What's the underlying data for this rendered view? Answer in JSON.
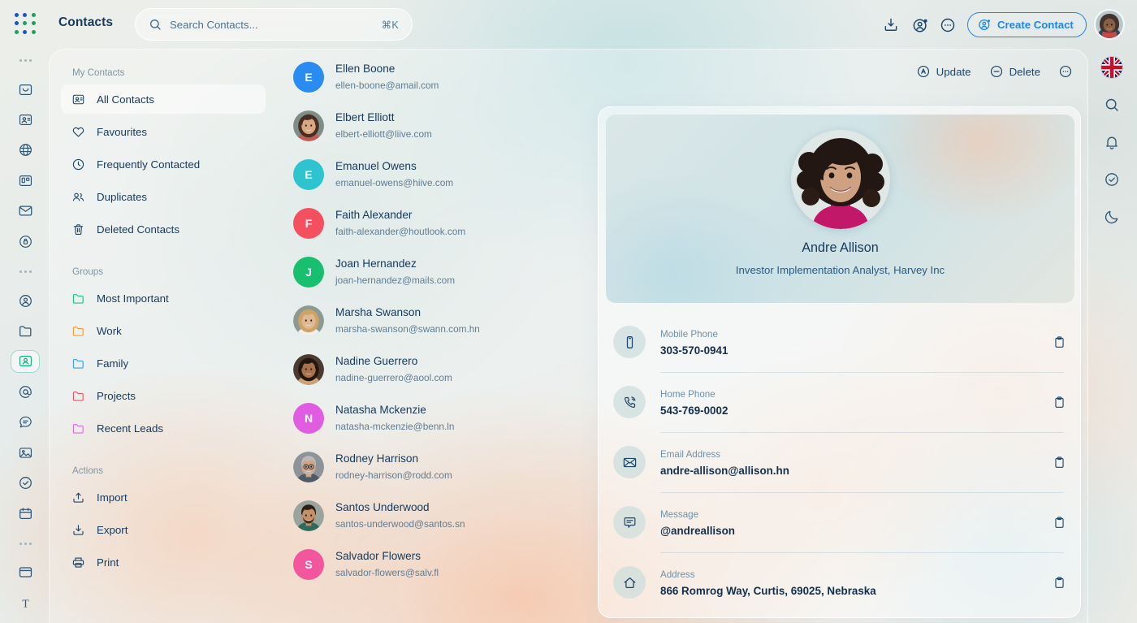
{
  "app": {
    "logo": "grid-dots-logo",
    "logo_colors": [
      "#1955c4",
      "#1955c4",
      "#18a35c",
      "#1955c4",
      "#18a35c",
      "#18a35c",
      "#18a35c",
      "#1955c4",
      "#18a35c"
    ],
    "title": "Contacts",
    "accent": "#1d85f7"
  },
  "search": {
    "placeholder": "Search Contacts...",
    "shortcut": "⌘K",
    "icon": "search-icon"
  },
  "toolbar": {
    "icons": [
      {
        "name": "download-icon"
      },
      {
        "name": "add-user-icon"
      },
      {
        "name": "more-horizontal-icon"
      }
    ],
    "create_contact_label": "Create Contact",
    "create_contact_icon": "user-plus-circle-icon",
    "avatar": "user-avatar"
  },
  "rail_left": {
    "items": [
      {
        "name": "more-dots-icon",
        "type": "dots"
      },
      {
        "name": "inbox-icon",
        "type": "icon"
      },
      {
        "name": "contact-card-icon",
        "type": "icon"
      },
      {
        "name": "globe-icon",
        "type": "icon"
      },
      {
        "name": "kanban-icon",
        "type": "icon"
      },
      {
        "name": "mail-icon",
        "type": "icon"
      },
      {
        "name": "id-badge-icon",
        "type": "icon"
      },
      {
        "name": "more-dots-icon",
        "type": "dots"
      },
      {
        "name": "user-circle-icon",
        "type": "icon"
      },
      {
        "name": "folder-icon",
        "type": "icon"
      },
      {
        "name": "contacts-icon",
        "type": "icon",
        "active": true
      },
      {
        "name": "at-sign-icon",
        "type": "icon"
      },
      {
        "name": "chat-icon",
        "type": "icon"
      },
      {
        "name": "image-icon",
        "type": "icon"
      },
      {
        "name": "check-circle-icon",
        "type": "icon"
      },
      {
        "name": "calendar-icon",
        "type": "icon"
      },
      {
        "name": "more-dots-icon",
        "type": "dots"
      },
      {
        "name": "window-icon",
        "type": "icon"
      },
      {
        "name": "text-icon",
        "type": "icon"
      }
    ]
  },
  "rail_right": {
    "items": [
      {
        "name": "language-flag-uk-icon",
        "type": "flag"
      },
      {
        "name": "search-icon",
        "type": "icon"
      },
      {
        "name": "bell-icon",
        "type": "icon"
      },
      {
        "name": "check-circle-icon",
        "type": "icon"
      },
      {
        "name": "moon-icon",
        "type": "icon"
      }
    ]
  },
  "sidebar": {
    "sections": [
      {
        "title": "My Contacts",
        "items": [
          {
            "label": "All Contacts",
            "icon": "contact-card-icon",
            "selected": true
          },
          {
            "label": "Favourites",
            "icon": "heart-icon",
            "selected": false
          },
          {
            "label": "Frequently Contacted",
            "icon": "clock-icon",
            "selected": false
          },
          {
            "label": "Duplicates",
            "icon": "users-icon",
            "selected": false
          },
          {
            "label": "Deleted Contacts",
            "icon": "trash-icon",
            "selected": false
          }
        ]
      },
      {
        "title": "Groups",
        "items": [
          {
            "label": "Most Important",
            "icon": "folder-icon",
            "color": "#21c08a",
            "selected": false
          },
          {
            "label": "Work",
            "icon": "folder-icon",
            "color": "#f59c3c",
            "selected": false
          },
          {
            "label": "Family",
            "icon": "folder-icon",
            "color": "#3b9cf5",
            "selected": false
          },
          {
            "label": "Projects",
            "icon": "folder-icon",
            "color": "#f2555a",
            "selected": false
          },
          {
            "label": "Recent Leads",
            "icon": "folder-icon",
            "color": "#e06ae0",
            "selected": false
          }
        ]
      },
      {
        "title": "Actions",
        "items": [
          {
            "label": "Import",
            "icon": "upload-icon",
            "selected": false
          },
          {
            "label": "Export",
            "icon": "download-icon",
            "selected": false
          },
          {
            "label": "Print",
            "icon": "printer-icon",
            "selected": false
          }
        ]
      }
    ]
  },
  "contact_list": [
    {
      "name": "Ellen Boone",
      "email": "ellen-boone@amail.com",
      "avatar_type": "initial",
      "initial": "E",
      "color": "#2a8cf0"
    },
    {
      "name": "Elbert Elliott",
      "email": "elbert-elliott@liive.com",
      "avatar_type": "photo",
      "photo": "woman-brown-hair"
    },
    {
      "name": "Emanuel Owens",
      "email": "emanuel-owens@hiive.com",
      "avatar_type": "initial",
      "initial": "E",
      "color": "#2ec4cf"
    },
    {
      "name": "Faith Alexander",
      "email": "faith-alexander@houtlook.com",
      "avatar_type": "initial",
      "initial": "F",
      "color": "#f4505f"
    },
    {
      "name": "Joan Hernandez",
      "email": "joan-hernandez@mails.com",
      "avatar_type": "initial",
      "initial": "J",
      "color": "#18bf6e"
    },
    {
      "name": "Marsha Swanson",
      "email": "marsha-swanson@swann.com.hn",
      "avatar_type": "photo",
      "photo": "woman-blonde"
    },
    {
      "name": "Nadine Guerrero",
      "email": "nadine-guerrero@aool.com",
      "avatar_type": "photo",
      "photo": "woman-dark-hair"
    },
    {
      "name": "Natasha Mckenzie",
      "email": "natasha-mckenzie@benn.ln",
      "avatar_type": "initial",
      "initial": "N",
      "color": "#e05ce0"
    },
    {
      "name": "Rodney Harrison",
      "email": "rodney-harrison@rodd.com",
      "avatar_type": "photo",
      "photo": "man-glasses-beard"
    },
    {
      "name": "Santos Underwood",
      "email": "santos-underwood@santos.sn",
      "avatar_type": "photo",
      "photo": "man-short-hair"
    },
    {
      "name": "Salvador Flowers",
      "email": "salvador-flowers@salv.fl",
      "avatar_type": "initial",
      "initial": "S",
      "color": "#f2579e"
    }
  ],
  "detail": {
    "actions": [
      {
        "label": "Update",
        "icon": "update-circle-icon"
      },
      {
        "label": "Delete",
        "icon": "minus-circle-icon"
      },
      {
        "label": "",
        "icon": "more-horizontal-icon"
      }
    ],
    "name": "Andre Allison",
    "role": "Investor Implementation Analyst, Harvey Inc",
    "photo": "woman-curly-dark-hair-magenta-top",
    "fields": [
      {
        "label": "Mobile Phone",
        "value": "303-570-0941",
        "icon": "mobile-phone-icon",
        "copy_icon": "clipboard-icon"
      },
      {
        "label": "Home Phone",
        "value": "543-769-0002",
        "icon": "phone-call-icon",
        "copy_icon": "clipboard-icon"
      },
      {
        "label": "Email Address",
        "value": "andre-allison@allison.hn",
        "icon": "envelope-icon",
        "copy_icon": "clipboard-icon"
      },
      {
        "label": "Message",
        "value": "@andreallison",
        "icon": "chat-bubble-icon",
        "copy_icon": "clipboard-icon"
      },
      {
        "label": "Address",
        "value": "866 Romrog Way, Curtis, 69025, Nebraska",
        "icon": "home-icon",
        "copy_icon": "clipboard-icon"
      }
    ]
  }
}
